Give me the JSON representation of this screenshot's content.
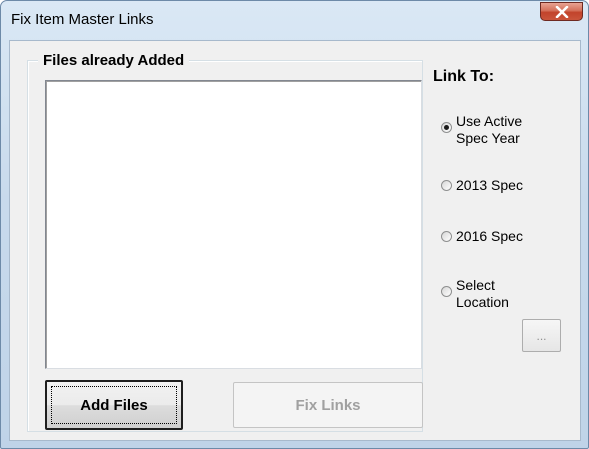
{
  "window": {
    "title": "Fix Item Master Links",
    "close_icon": "close-x-icon"
  },
  "files_group": {
    "legend": "Files already Added",
    "items": []
  },
  "buttons": {
    "add_files": "Add Files",
    "fix_links": "Fix Links",
    "fix_links_enabled": false,
    "browse": "..."
  },
  "link_to": {
    "label": "Link To:",
    "selected": "use-active",
    "options": [
      {
        "id": "use-active",
        "label": "Use Active\nSpec Year",
        "checked": true
      },
      {
        "id": "2013",
        "label": "2013 Spec",
        "checked": false
      },
      {
        "id": "2016",
        "label": "2016 Spec",
        "checked": false
      },
      {
        "id": "select-location",
        "label": "Select\nLocation",
        "checked": false
      }
    ]
  },
  "colors": {
    "close_button": "#c9553c",
    "client_bg": "#f0f0f0",
    "disabled_text": "#a0a0a0"
  }
}
